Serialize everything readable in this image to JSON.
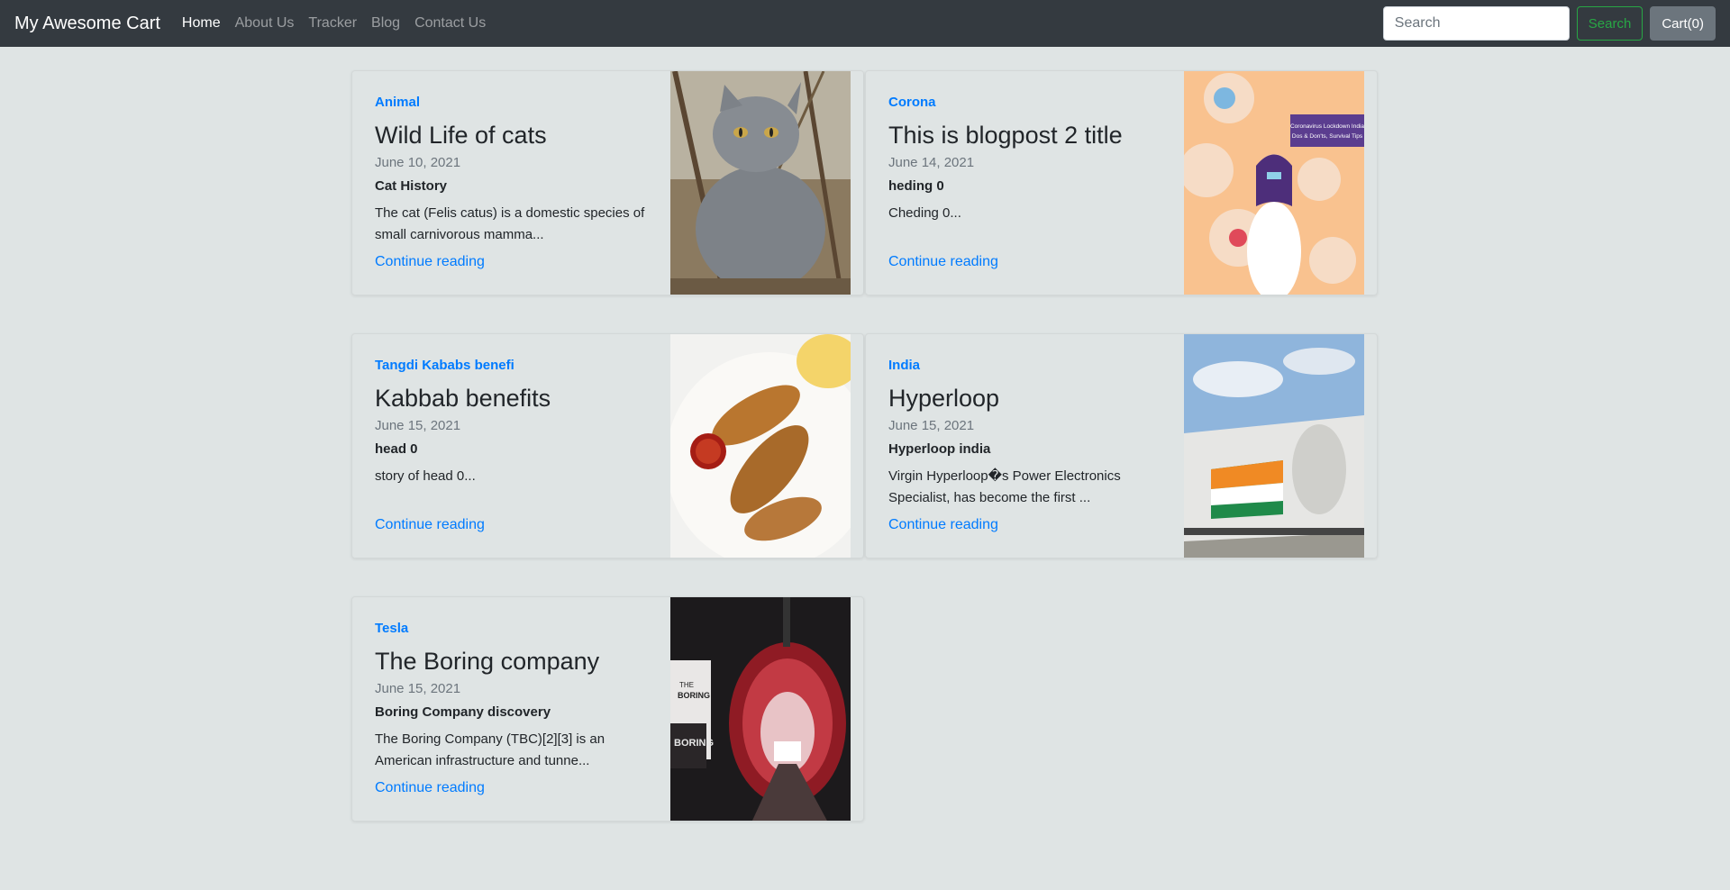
{
  "navbar": {
    "brand": "My Awesome Cart",
    "links": [
      "Home",
      "About Us",
      "Tracker",
      "Blog",
      "Contact Us"
    ],
    "search_placeholder": "Search",
    "search_button": "Search",
    "cart_button": "Cart(0)"
  },
  "posts": [
    {
      "category": "Animal",
      "title": "Wild Life of cats",
      "date": "June 10, 2021",
      "heading": "Cat History",
      "excerpt": "The cat (Felis catus) is a domestic species of small carnivorous mamma...",
      "link": "Continue reading",
      "image_icon": "cat-photo"
    },
    {
      "category": "Corona",
      "title": "This is blogpost 2 title",
      "date": "June 14, 2021",
      "heading": "heding 0",
      "excerpt": "Cheding 0...",
      "link": "Continue reading",
      "image_icon": "corona-illustration",
      "image_text": "Coronavirus Lockdown India Dos & Don'ts, Survival Tips"
    },
    {
      "category": "Tangdi Kababs benefi",
      "title": "Kabbab benefits",
      "date": "June 15, 2021",
      "heading": "head 0",
      "excerpt": "story of head 0...",
      "link": "Continue reading",
      "image_icon": "kabab-photo"
    },
    {
      "category": "India",
      "title": "Hyperloop",
      "date": "June 15, 2021",
      "heading": "Hyperloop india",
      "excerpt": "Virgin Hyperloop�s Power Electronics Specialist, has become the first ...",
      "link": "Continue reading",
      "image_icon": "hyperloop-photo"
    },
    {
      "category": "Tesla",
      "title": "The Boring company",
      "date": "June 15, 2021",
      "heading": "Boring Company discovery",
      "excerpt": "The Boring Company (TBC)[2][3] is an American infrastructure and tunne...",
      "link": "Continue reading",
      "image_icon": "tunnel-photo",
      "image_text": "THE BORING COMPANY"
    }
  ],
  "colors": {
    "navbar_bg": "#343a40",
    "page_bg": "#dfe4e4",
    "link": "#007bff",
    "search_btn": "#28a745",
    "cart_btn": "#6c757d"
  }
}
